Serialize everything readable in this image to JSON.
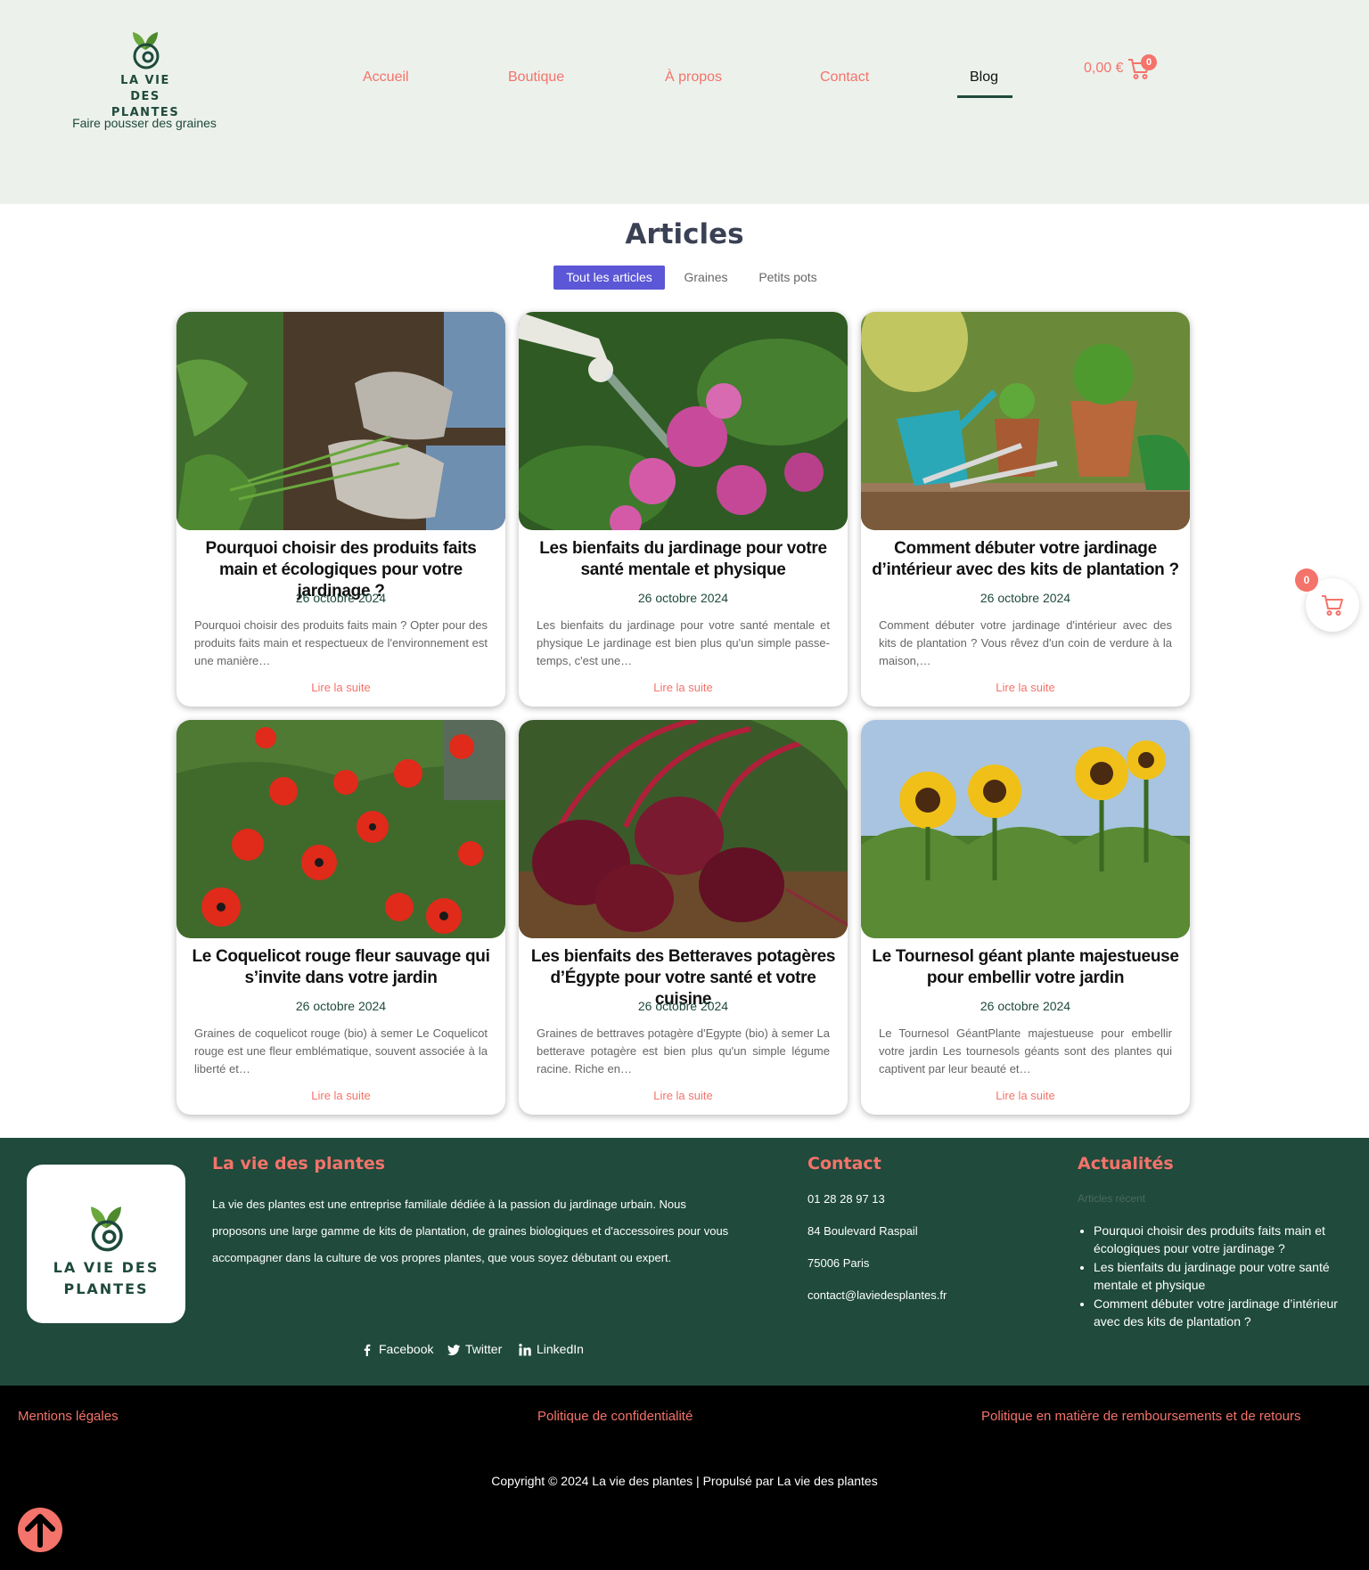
{
  "header": {
    "logo_line1": "LA VIE DES",
    "logo_line2": "PLANTES",
    "tagline": "Faire pousser des graines",
    "nav": [
      "Accueil",
      "Boutique",
      "À propos",
      "Contact",
      "Blog"
    ],
    "active_nav": "Blog",
    "cart_total": "0,00 €",
    "cart_count": "0"
  },
  "articles": {
    "title": "Articles",
    "filters": [
      "Tout les articles",
      "Graines",
      "Petits pots"
    ],
    "active_filter": "Tout les articles",
    "read_more": "Lire la suite",
    "items": [
      {
        "title": "Pourquoi choisir des produits faits main et écologiques pour votre jardinage ?",
        "date": "26 octobre 2024",
        "excerpt": "Pourquoi choisir des produits faits main ? Opter pour des produits faits main et respectueux de l'environnement est une manière…",
        "image": "gardening-gloves-photo"
      },
      {
        "title": "Les bienfaits du jardinage pour votre santé mentale et physique",
        "date": "26 octobre 2024",
        "excerpt": "Les bienfaits du jardinage pour votre santé mentale et physique Le jardinage est bien plus qu'un simple passe-temps, c'est une…",
        "image": "watering-flowers-photo"
      },
      {
        "title": "Comment débuter votre jardinage d’intérieur avec des kits de plantation ?",
        "date": "26 octobre 2024",
        "excerpt": "Comment débuter votre jardinage d'intérieur avec des kits de plantation ? Vous rêvez d'un coin de verdure à la maison,…",
        "image": "garden-tools-pots-photo"
      },
      {
        "title": "Le Coquelicot rouge fleur sauvage qui s’invite dans votre jardin",
        "date": "26 octobre 2024",
        "excerpt": "Graines de coquelicot rouge (bio) à semer Le Coquelicot rouge est une fleur emblématique, souvent associée à la liberté et…",
        "image": "red-poppies-photo"
      },
      {
        "title": "Les bienfaits des Betteraves potagères d’Égypte pour votre santé et votre cuisine",
        "date": "26 octobre 2024",
        "excerpt": "Graines de bettraves potagère d'Egypte (bio) à semer La betterave potagère est bien plus qu'un simple légume racine. Riche en…",
        "image": "beetroots-photo"
      },
      {
        "title": "Le Tournesol géant plante majestueuse pour embellir votre jardin",
        "date": "26 octobre 2024",
        "excerpt": "Le Tournesol GéantPlante majestueuse pour embellir votre jardin Les tournesols géants sont des plantes qui captivent par leur beauté et…",
        "image": "sunflowers-photo"
      }
    ]
  },
  "floating_cart": {
    "count": "0"
  },
  "footer": {
    "logo_line1": "LA VIE DES",
    "logo_line2": "PLANTES",
    "about_heading": "La vie des plantes",
    "about_text": "La vie des plantes est une entreprise familiale dédiée à la passion du jardinage urbain. Nous proposons une large gamme de kits de plantation, de graines biologiques et d'accessoires pour vous accompagner dans la culture de vos propres plantes, que vous soyez débutant ou expert.",
    "contact_heading": "Contact",
    "phone": "01 28 28 97 13",
    "address": "84 Boulevard Raspail",
    "city": "75006  Paris",
    "email": "contact@laviedesplantes.fr",
    "news_heading": "Actualités",
    "recent_label": "Articles récent",
    "news": [
      "Pourquoi choisir des produits faits main et écologiques pour votre jardinage ?",
      "Les bienfaits du jardinage pour votre santé mentale et physique",
      "Comment débuter votre jardinage d’intérieur avec des kits de plantation ?"
    ],
    "social": [
      "Facebook",
      "Twitter",
      "LinkedIn"
    ]
  },
  "bottom": {
    "legal": [
      "Mentions légales",
      "Politique de confidentialité",
      "Politique en matière de remboursements et de retours"
    ],
    "copyright": "Copyright © 2024 La vie des plantes | Propulsé par La vie des plantes"
  },
  "colors": {
    "accent": "#f4736a",
    "brand_green": "#1f4a3c",
    "header_bg": "#ecf1ec",
    "filter_active": "#5b57d6"
  }
}
